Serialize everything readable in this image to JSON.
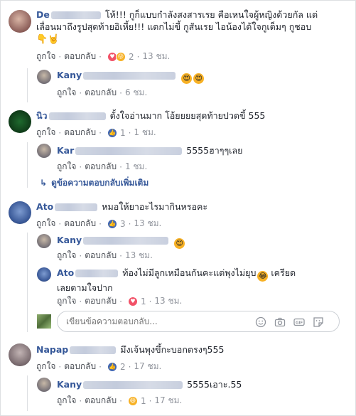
{
  "labels": {
    "like": "ถูกใจ",
    "reply": "ตอบกลับ",
    "dot": "·"
  },
  "c1": {
    "name": "De",
    "line1": "โห้!!! กูก็แบบกำลังสงสารเรย คือเหนใจผู้หญิงด้วยกัล แต่",
    "line2": "เลื่อนมาถึงรูปสุดท้ายอิเหี้ย!!! แดกไม่ขี้ กูสันเรย ไอน้องได้ใจกูเต็มๆ กูชอบ",
    "reactions": "2",
    "time": "13 ชม."
  },
  "r1": {
    "name": "Kany",
    "time": "6 ชม."
  },
  "c2": {
    "name": "นิว",
    "text": "ตั้งใจอ่านมาก โอ้ยยยยสุดท้ายปวดขี้ 555",
    "reactions": "1",
    "time": "1 ชม."
  },
  "r2": {
    "name": "Kar",
    "text": "5555ฮาๆๆเลย",
    "time": "1 ชม."
  },
  "more_replies": "ดูข้อความตอบกลับเพิ่มเติม",
  "c3": {
    "name": "Ato",
    "text": "หมอให้ยาอะไรมากินหรอคะ",
    "reactions": "3",
    "time": "13 ชม."
  },
  "r3": {
    "name": "Kany",
    "time": "13 ชม."
  },
  "r4": {
    "name": "Ato",
    "line1": "ท้องไม่มีลูกเหมือนกันคะแต่พุงไม่ยุบ",
    "line1b": "เครียด",
    "line2": "เลยตามใจปาก",
    "reactions": "1",
    "time": "13 ชม."
  },
  "reply_input": {
    "placeholder": "เขียนข้อความตอบกลับ..."
  },
  "c4": {
    "name": "Napap",
    "text": "มึงเจ้นพุงขึ้กะบอกตรงๆ555",
    "reactions": "2",
    "time": "17 ชม."
  },
  "r5": {
    "name": "Kany",
    "text": "5555เอาะ.55",
    "reactions": "1",
    "time": "17 ชม."
  },
  "colors": {
    "link": "#365899",
    "meta": "#90949c",
    "like": "#4267b2",
    "love": "#f25268",
    "haha": "#f7b125"
  }
}
